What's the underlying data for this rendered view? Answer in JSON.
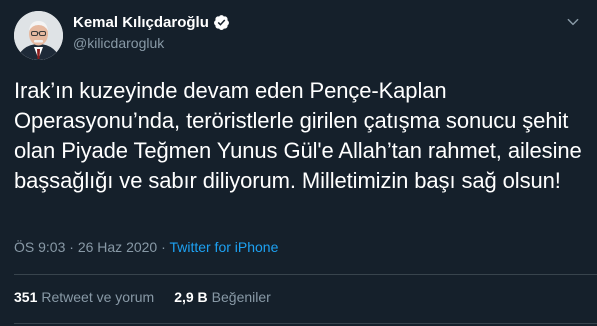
{
  "author": {
    "display_name": "Kemal Kılıçdaroğlu",
    "handle": "@kilicdarogluk",
    "verified": true
  },
  "tweet": {
    "text": "Irak’ın kuzeyinde devam eden Pençe-Kaplan Operasyonu’nda, teröristlerle girilen çatışma sonucu şehit olan Piyade Teğmen Yunus Gül'e Allah’tan rahmet, ailesine başsağlığı ve sabır diliyorum. Milletimizin başı sağ olsun!",
    "time": "ÖS 9:03",
    "separator": "·",
    "date": "26 Haz 2020",
    "source": "Twitter for iPhone"
  },
  "stats": {
    "retweets_count": "351",
    "retweets_label": "Retweet ve yorum",
    "likes_count": "2,9 B",
    "likes_label": "Beğeniler"
  },
  "colors": {
    "background": "#15202b",
    "secondary_text": "#8899a6",
    "accent": "#1da1f2",
    "divider": "#38444d"
  }
}
